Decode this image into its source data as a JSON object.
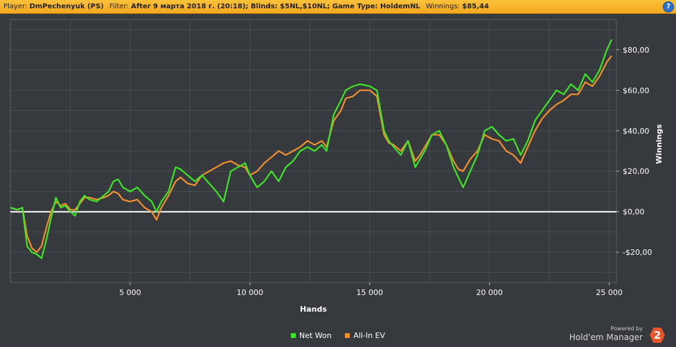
{
  "header": {
    "player_label": "Player:",
    "player_value": "DmPechenyuk (PS)",
    "filter_label": "Filter:",
    "filter_value": "After 9 марта 2018 г. (20:18); Blinds: $5NL,$10NL; Game Type: HoldemNL",
    "winnings_label": "Winnings:",
    "winnings_value": "$85,44",
    "help_icon": "question-icon"
  },
  "branding": {
    "powered_by": "Powered by",
    "product": "Hold'em Manager",
    "logo_text": "2"
  },
  "colors": {
    "net_won": "#3de626",
    "all_in_ev": "#f2902e",
    "zero_line": "#ffffff",
    "background": "#36393d",
    "grid": "#4a4d52"
  },
  "chart_data": {
    "type": "line",
    "title": "",
    "xlabel": "Hands",
    "ylabel": "Winnings",
    "xlim": [
      0,
      25300
    ],
    "ylim": [
      -35,
      95
    ],
    "grid": true,
    "legend_position": "bottom",
    "x_ticks": [
      5000,
      10000,
      15000,
      20000,
      25000
    ],
    "x_tick_labels": [
      "5 000",
      "10 000",
      "15 000",
      "20 000",
      "25 000"
    ],
    "y_ticks": [
      -20,
      0,
      20,
      40,
      60,
      80
    ],
    "y_tick_labels": [
      "-$20,00",
      "$0,00",
      "$20,00",
      "$40,00",
      "$60,00",
      "$80,00"
    ],
    "x": [
      0,
      300,
      500,
      700,
      900,
      1100,
      1300,
      1500,
      1700,
      1900,
      2100,
      2300,
      2500,
      2700,
      2900,
      3100,
      3300,
      3600,
      3900,
      4100,
      4300,
      4500,
      4700,
      5000,
      5300,
      5600,
      5900,
      6100,
      6300,
      6600,
      6900,
      7100,
      7400,
      7700,
      8000,
      8300,
      8600,
      8900,
      9200,
      9500,
      9800,
      10000,
      10300,
      10600,
      10900,
      11200,
      11500,
      11800,
      12100,
      12400,
      12700,
      13000,
      13200,
      13500,
      13800,
      14000,
      14300,
      14600,
      15000,
      15300,
      15600,
      15800,
      16000,
      16300,
      16600,
      16900,
      17100,
      17300,
      17600,
      17900,
      18200,
      18500,
      18700,
      18900,
      19200,
      19500,
      19800,
      20100,
      20400,
      20700,
      21000,
      21300,
      21600,
      21900,
      22200,
      22500,
      22800,
      23100,
      23400,
      23700,
      24000,
      24300,
      24600,
      24900,
      25100
    ],
    "series": [
      {
        "name": "Net Won",
        "values": [
          2,
          1,
          2,
          -17,
          -20,
          -21,
          -23,
          -14,
          -3,
          7,
          2,
          3,
          0,
          -2,
          5,
          8,
          6,
          5,
          8,
          10,
          15,
          16,
          12,
          10,
          12,
          8,
          5,
          0,
          5,
          10,
          22,
          21,
          18,
          15,
          18,
          14,
          10,
          5,
          20,
          22,
          24,
          18,
          12,
          15,
          20,
          15,
          22,
          25,
          30,
          32,
          30,
          33,
          30,
          48,
          55,
          60,
          62,
          63,
          62,
          60,
          40,
          35,
          32,
          28,
          35,
          22,
          26,
          30,
          38,
          40,
          33,
          22,
          17,
          12,
          20,
          28,
          40,
          42,
          38,
          35,
          36,
          28,
          35,
          45,
          50,
          55,
          60,
          58,
          63,
          60,
          68,
          64,
          70,
          80,
          85
        ]
      },
      {
        "name": "All-In EV",
        "values": [
          2,
          1,
          2,
          -12,
          -18,
          -20,
          -17,
          -8,
          0,
          5,
          3,
          4,
          1,
          1,
          4,
          7,
          7,
          6,
          7,
          8,
          10,
          9,
          6,
          5,
          6,
          2,
          0,
          -4,
          2,
          8,
          15,
          17,
          14,
          13,
          18,
          20,
          22,
          24,
          25,
          23,
          22,
          18,
          20,
          24,
          27,
          30,
          28,
          30,
          32,
          35,
          33,
          35,
          32,
          45,
          50,
          56,
          57,
          60,
          60,
          57,
          38,
          34,
          33,
          30,
          35,
          25,
          28,
          32,
          38,
          38,
          33,
          25,
          21,
          20,
          26,
          30,
          38,
          36,
          35,
          30,
          28,
          24,
          32,
          40,
          46,
          50,
          53,
          55,
          58,
          58,
          64,
          62,
          67,
          74,
          77
        ]
      }
    ]
  }
}
